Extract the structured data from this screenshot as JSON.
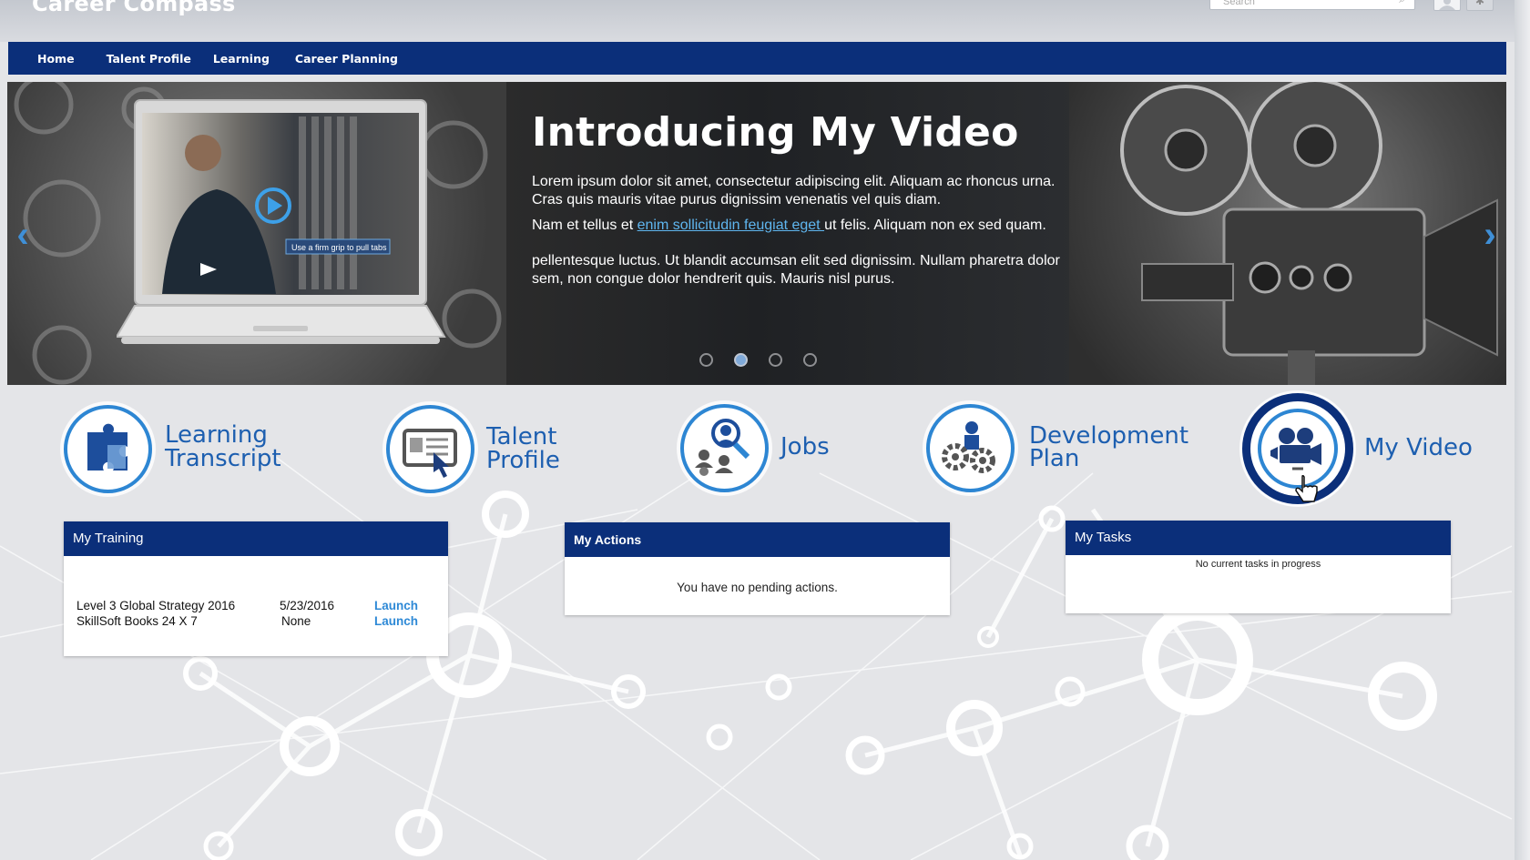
{
  "header": {
    "brand": "Career Compass",
    "search_placeholder": "Search"
  },
  "nav": {
    "items": [
      {
        "label": "Home"
      },
      {
        "label": "Talent Profile"
      },
      {
        "label": "Learning"
      },
      {
        "label": "Career Planning"
      }
    ]
  },
  "hero": {
    "title": "Introducing My Video",
    "paragraph1": "Lorem ipsum dolor sit amet, consectetur adipiscing elit. Aliquam ac rhoncus urna. Cras quis mauris vitae purus dignissim venenatis vel quis diam.",
    "paragraph2_before": "Nam et tellus et ",
    "paragraph2_link": "enim sollicitudin feugiat eget ",
    "paragraph2_after": "ut felis. Aliquam non ex sed quam.",
    "paragraph3": "pellentesque luctus. Ut blandit accumsan elit sed dignissim. Nullam pharetra dolor sem, non congue dolor hendrerit quis. Mauris nisl purus.",
    "video_caption": "Use a firm grip to pull tabs",
    "slides": 4,
    "active_slide": 2
  },
  "tiles": [
    {
      "line1": "Learning",
      "line2": "Transcript",
      "icon": "puzzle-icon"
    },
    {
      "line1": "Talent",
      "line2": "Profile",
      "icon": "profile-card-icon"
    },
    {
      "line1": "Jobs",
      "line2": "",
      "icon": "people-search-icon"
    },
    {
      "line1": "Development",
      "line2": "Plan",
      "icon": "gears-person-icon"
    },
    {
      "line1": "My Video",
      "line2": "",
      "icon": "video-camera-icon"
    }
  ],
  "training": {
    "title": "My Training",
    "rows": [
      {
        "course": "Level 3 Global Strategy 2016",
        "date": "5/23/2016",
        "action": "Launch"
      },
      {
        "course": "SkillSoft Books 24 X 7",
        "date": "None",
        "action": "Launch"
      }
    ]
  },
  "actions": {
    "title": "My Actions",
    "message": "You have no pending actions."
  },
  "tasks": {
    "title": "My Tasks",
    "message": "No current tasks in progress"
  },
  "colors": {
    "nav_blue": "#0b2f7a",
    "accent_blue": "#2d86d3",
    "link_blue": "#2e89d6"
  }
}
